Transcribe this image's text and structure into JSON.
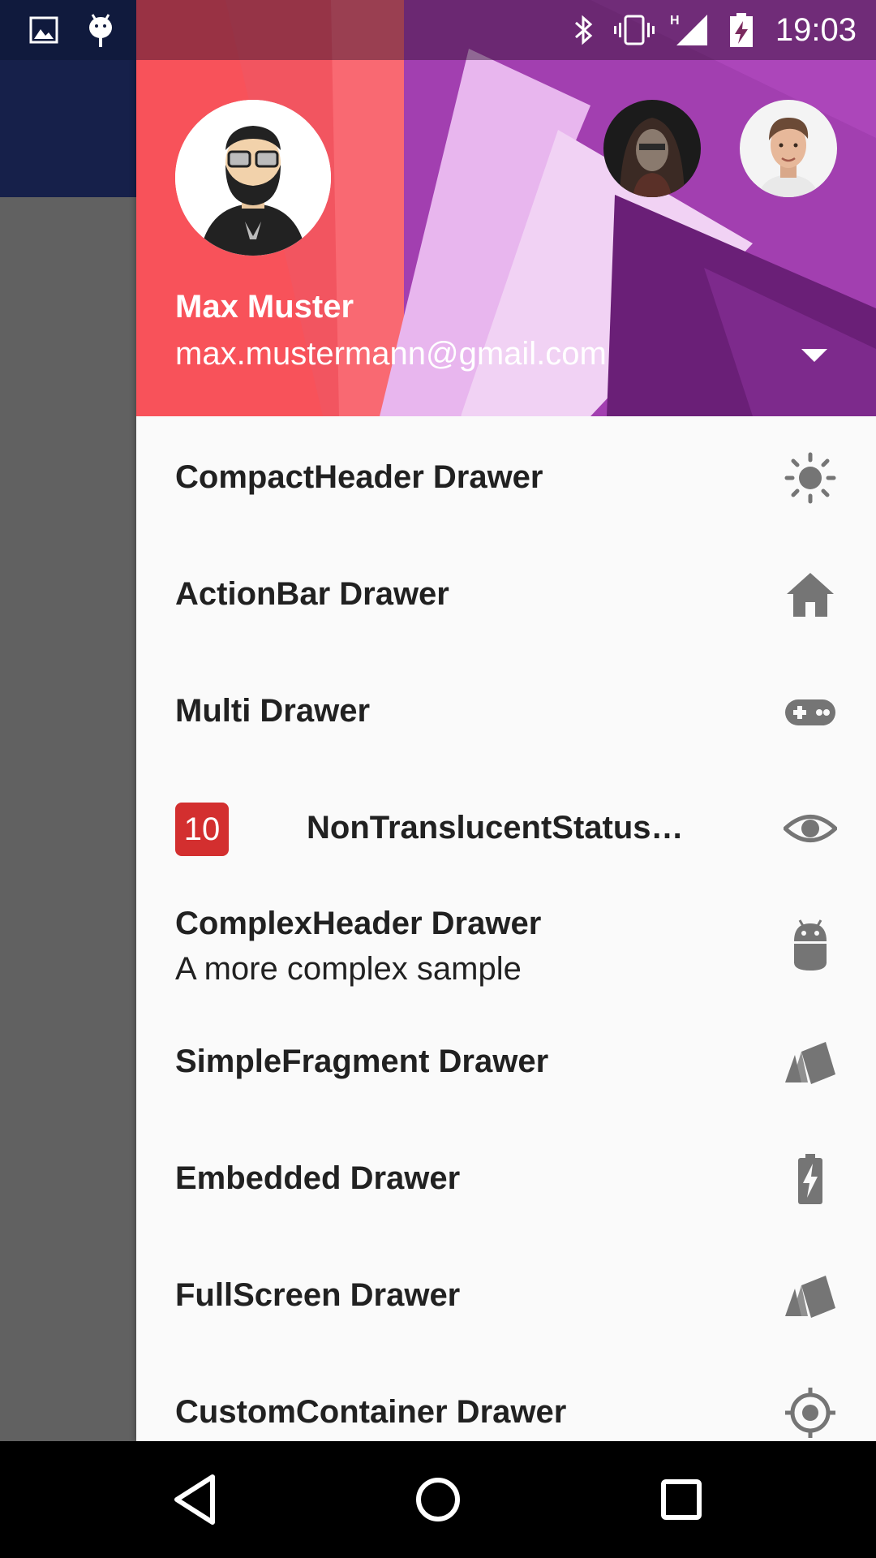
{
  "status_bar": {
    "time": "19:03",
    "left_icons": [
      "image-icon",
      "android-debug-icon"
    ],
    "right_icons": [
      "bluetooth-icon",
      "vibrate-icon",
      "signal-h-icon",
      "battery-charging-icon"
    ]
  },
  "drawer": {
    "header": {
      "profile_name": "Max Muster",
      "profile_email": "max.mustermann@gmail.com",
      "accent_color": "#f8525a",
      "secondary_color": "#9c27b0"
    },
    "items": [
      {
        "label": "CompactHeader Drawer",
        "icon": "brightness-icon"
      },
      {
        "label": "ActionBar Drawer",
        "icon": "home-icon"
      },
      {
        "label": "Multi Drawer",
        "icon": "gamepad-icon"
      },
      {
        "label": "NonTranslucentStatus…",
        "badge": "10",
        "icon": "eye-icon"
      },
      {
        "label": "ComplexHeader Drawer",
        "sub": "A more complex sample",
        "icon": "android-icon"
      },
      {
        "label": "SimpleFragment Drawer",
        "icon": "cards-icon"
      },
      {
        "label": "Embedded Drawer",
        "icon": "battery-bolt-icon"
      },
      {
        "label": "FullScreen Drawer",
        "icon": "cards-icon"
      },
      {
        "label": "CustomContainer Drawer",
        "icon": "crosshair-icon"
      }
    ]
  },
  "nav_bar": {
    "buttons": [
      "back",
      "home",
      "recents"
    ]
  }
}
